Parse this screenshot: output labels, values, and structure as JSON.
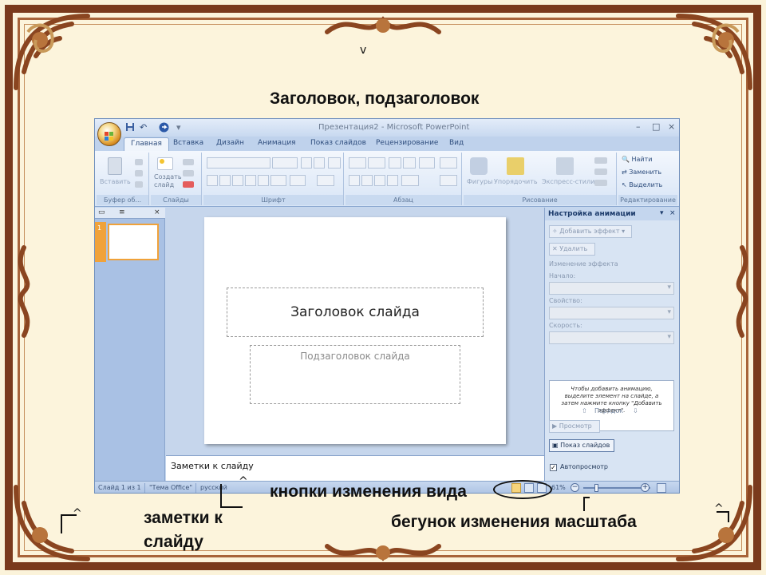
{
  "captions": {
    "title": "Заголовок, подзаголовок",
    "views": "кнопки изменения вида",
    "notes": "заметки к слайду",
    "zoom": "бегунок изменения масштаба"
  },
  "window": {
    "title": "Презентация2 - Microsoft PowerPoint",
    "controls": [
      "–",
      "□",
      "×"
    ]
  },
  "quick_access": [
    "save-icon",
    "undo-icon",
    "redo-icon"
  ],
  "tabs": [
    "Главная",
    "Вставка",
    "Дизайн",
    "Анимация",
    "Показ слайдов",
    "Рецензирование",
    "Вид"
  ],
  "ribbon": {
    "groups": [
      "Буфер об...",
      "Слайды",
      "Шрифт",
      "Абзац",
      "Рисование",
      "Редактирование"
    ],
    "paste": "Вставить",
    "new_slide": "Создать слайд",
    "shapes": "Фигуры",
    "arrange": "Упорядочить",
    "quick_styles": "Экспресс-стили",
    "find": "Найти",
    "replace": "Заменить",
    "select": "Выделить"
  },
  "slides_pane": {
    "slide_number": "1"
  },
  "slide": {
    "title_placeholder": "Заголовок слайда",
    "subtitle_placeholder": "Подзаголовок слайда"
  },
  "notes": {
    "placeholder": "Заметки к слайду"
  },
  "task_pane": {
    "title": "Настройка анимации",
    "add_effect": "Добавить эффект",
    "remove": "Удалить",
    "change_effect": "Изменение эффекта",
    "start": "Начало:",
    "property": "Свойство:",
    "speed": "Скорость:",
    "info": "Чтобы добавить анимацию, выделите элемент на слайде, а затем нажмите кнопку \"Добавить эффект\".",
    "reorder": "Порядок",
    "preview": "Просмотр",
    "slide_show": "Показ слайдов",
    "autopreview": "Автопросмотр"
  },
  "status": {
    "slide": "Слайд 1 из 1",
    "theme": "\"Тема Office\"",
    "language": "русский",
    "zoom": "61%"
  }
}
